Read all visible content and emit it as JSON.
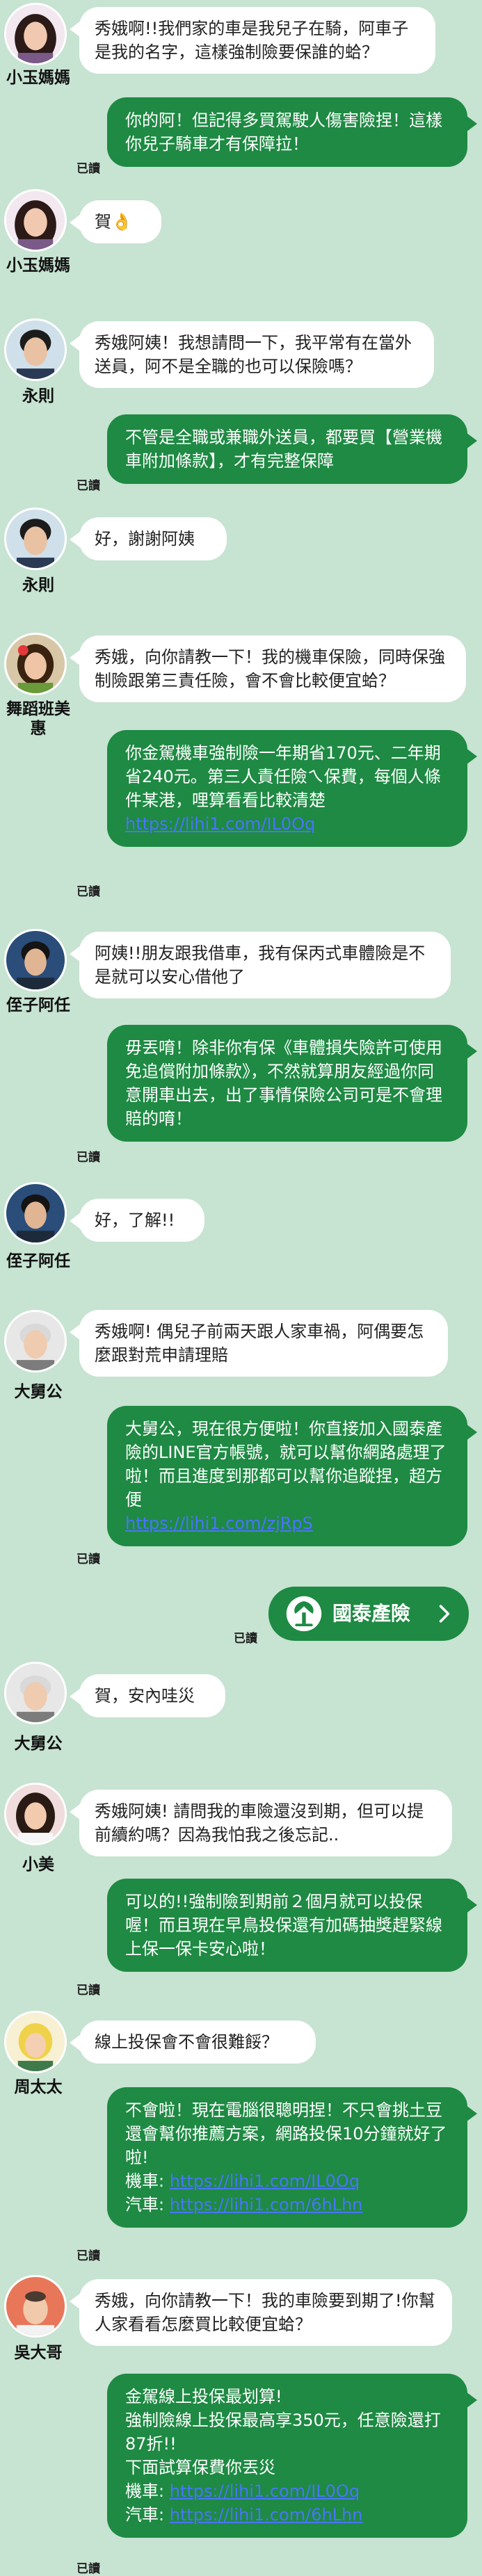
{
  "read_label": "已讀",
  "messages": [
    {
      "name": "小玉媽媽",
      "text": "秀娥啊!!我們家的車是我兒子在騎，阿車子是我的名字，這樣強制險要保誰的蛤？"
    },
    {
      "text": "你的阿！但記得多買駕駛人傷害險捏！這樣你兒子騎車才有保障拉！"
    },
    {
      "name": "小玉媽媽",
      "text": "賀👌"
    },
    {
      "name": "永則",
      "text": "秀娥阿姨！我想請問一下，我平常有在當外送員，阿不是全職的也可以保險嗎？"
    },
    {
      "text": "不管是全職或兼職外送員，都要買【營業機車附加條款】，才有完整保障"
    },
    {
      "name": "永則",
      "text": "好，謝謝阿姨"
    },
    {
      "name": "舞蹈班美惠",
      "text": "秀娥，向你請教一下！我的機車保險，同時保強制險跟第三責任險，會不會比較便宜蛤？"
    },
    {
      "text": "你金駕機車強制險一年期省170元、二年期省240元。第三人責任險ㄟ保費，每個人條件某港，哩算看看比較清楚",
      "link": "https://lihi1.com/IL0Oq"
    },
    {
      "name": "侄子阿任",
      "text": "阿姨!!朋友跟我借車，我有保丙式車體險是不是就可以安心借他了"
    },
    {
      "text": "毋丟唷！除非你有保《車體損失險許可使用免追償附加條款》，不然就算朋友經過你同意開車出去，出了事情保險公司可是不會理賠的唷！"
    },
    {
      "name": "侄子阿任",
      "text": "好，了解!!"
    },
    {
      "name": "大舅公",
      "text": "秀娥啊! 偶兒子前兩天跟人家車禍，阿偶要怎麼跟對荒申請理賠"
    },
    {
      "text": "大舅公，現在很方便啦！你直接加入國泰產險的LINE官方帳號，就可以幫你網路處理了啦！而且進度到那都可以幫你追蹤捏，超方便",
      "link": "https://lihi1.com/zjRpS"
    },
    {
      "card": "國泰產險"
    },
    {
      "name": "大舅公",
      "text": "賀，安內哇災"
    },
    {
      "name": "小美",
      "text": "秀娥阿姨! 請問我的車險還沒到期，但可以提前續約嗎？因為我怕我之後忘記.."
    },
    {
      "text": "可以的!!強制險到期前２個月就可以投保喔！而且現在早鳥投保還有加碼抽獎趕緊線上保一保卡安心啦！"
    },
    {
      "name": "周太太",
      "text": "線上投保會不會很難餒？"
    },
    {
      "text": "不會啦！現在電腦很聰明捏！不只會挑土豆還會幫你推薦方案，網路投保10分鐘就好了啦!",
      "lines": [
        {
          "label": "機車: ",
          "link": "https://lihi1.com/IL0Oq"
        },
        {
          "label": "汽車: ",
          "link": "https://lihi1.com/6hLhn"
        }
      ]
    },
    {
      "name": "吳大哥",
      "text": "秀娥，向你請教一下！我的車險要到期了!你幫人家看看怎麼買比較便宜蛤？"
    },
    {
      "text": "金駕線上投保最划算!\n強制險線上投保最高享350元，任意險還打87折!!\n下面試算保費你丟災",
      "lines": [
        {
          "label": "機車: ",
          "link": "https://lihi1.com/IL0Oq"
        },
        {
          "label": "汽車: ",
          "link": "https://lihi1.com/6hLhn"
        }
      ]
    }
  ]
}
